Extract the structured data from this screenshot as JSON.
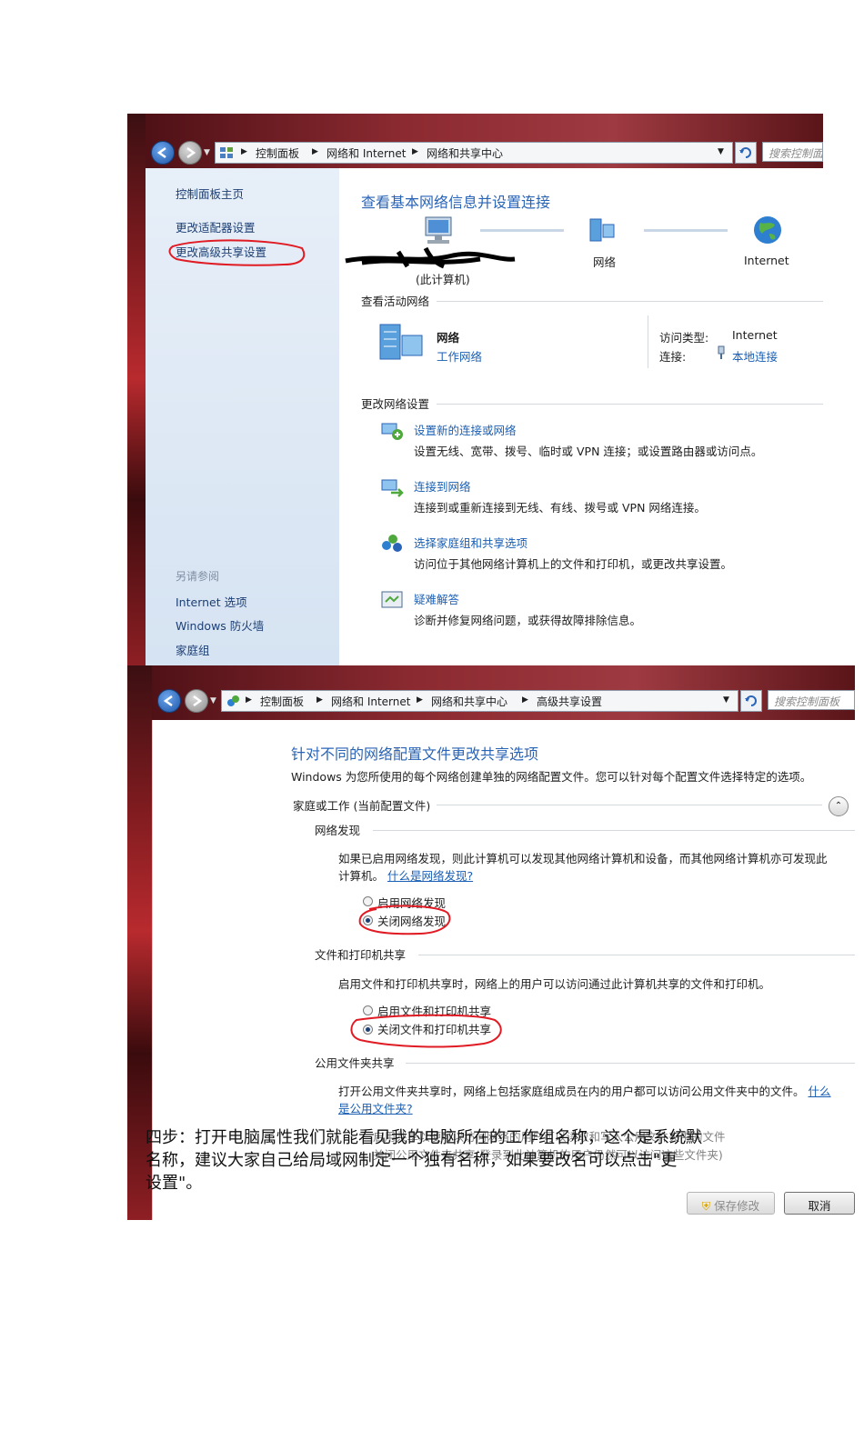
{
  "window1": {
    "breadcrumb": [
      "控制面板",
      "网络和 Internet",
      "网络和共享中心"
    ],
    "search_placeholder": "搜索控制面",
    "sidebar": {
      "items": [
        "控制面板主页",
        "更改适配器设置",
        "更改高级共享设置"
      ],
      "see_also_label": "另请参阅",
      "see_also": [
        "Internet 选项",
        "Windows 防火墙",
        "家庭组"
      ]
    },
    "main": {
      "title": "查看基本网络信息并设置连接",
      "map": {
        "computer_label": "(此计算机)",
        "network_label": "网络",
        "internet_label": "Internet"
      },
      "active_networks_label": "查看活动网络",
      "network": {
        "name": "网络",
        "type": "工作网络",
        "access_type_label": "访问类型:",
        "access_type_value": "Internet",
        "connection_label": "连接:",
        "connection_value": "本地连接"
      },
      "change_settings_label": "更改网络设置",
      "tasks": [
        {
          "title": "设置新的连接或网络",
          "desc": "设置无线、宽带、拨号、临时或 VPN 连接；或设置路由器或访问点。"
        },
        {
          "title": "连接到网络",
          "desc": "连接到或重新连接到无线、有线、拨号或 VPN 网络连接。"
        },
        {
          "title": "选择家庭组和共享选项",
          "desc": "访问位于其他网络计算机上的文件和打印机，或更改共享设置。"
        },
        {
          "title": "疑难解答",
          "desc": "诊断并修复网络问题，或获得故障排除信息。"
        }
      ]
    }
  },
  "window2": {
    "breadcrumb": [
      "控制面板",
      "网络和 Internet",
      "网络和共享中心",
      "高级共享设置"
    ],
    "search_placeholder": "搜索控制面板",
    "title": "针对不同的网络配置文件更改共享选项",
    "intro": "Windows 为您所使用的每个网络创建单独的网络配置文件。您可以针对每个配置文件选择特定的选项。",
    "profile_label": "家庭或工作 (当前配置文件)",
    "discovery": {
      "heading": "网络发现",
      "desc": "如果已启用网络发现，则此计算机可以发现其他网络计算机和设备，而其他网络计算机亦可发现此计算机。",
      "help_link": "什么是网络发现?",
      "on_label": "启用网络发现",
      "off_label": "关闭网络发现"
    },
    "file_sharing": {
      "heading": "文件和打印机共享",
      "desc": "启用文件和打印机共享时，网络上的用户可以访问通过此计算机共享的文件和打印机。",
      "on_label": "启用文件和打印机共享",
      "off_label": "关闭文件和打印机共享"
    },
    "public_folder": {
      "heading": "公用文件夹共享",
      "desc": "打开公用文件夹共享时，网络上包括家庭组成员在内的用户都可以访问公用文件夹中的文件。",
      "help_link_1": "什么",
      "help_link_2": "是公用文件夹?",
      "overlap_1": "启用共享以便可以访问网络的用户可以读取和写入公用文件夹中的文件",
      "overlap_2": "关闭公用文件夹共享(登录到此计算机的用户仍然可以访问这些文件夹)"
    },
    "save_button": "保存修改",
    "cancel_button": "取消"
  },
  "caption": {
    "line1": "四步：打开电脑属性我们就能看见我的电脑所在的工作组名称，这个是系统默",
    "line2": "名称，建议大家自己给局域网制定一个独有名称，如果要改名可以点击\"更",
    "line3": "设置\"。"
  },
  "colors": {
    "link": "#1a5fb4",
    "title_blue": "#2a64b6",
    "annotation_red": "#e01b24",
    "sidebar_bg": "#dce7f4"
  }
}
